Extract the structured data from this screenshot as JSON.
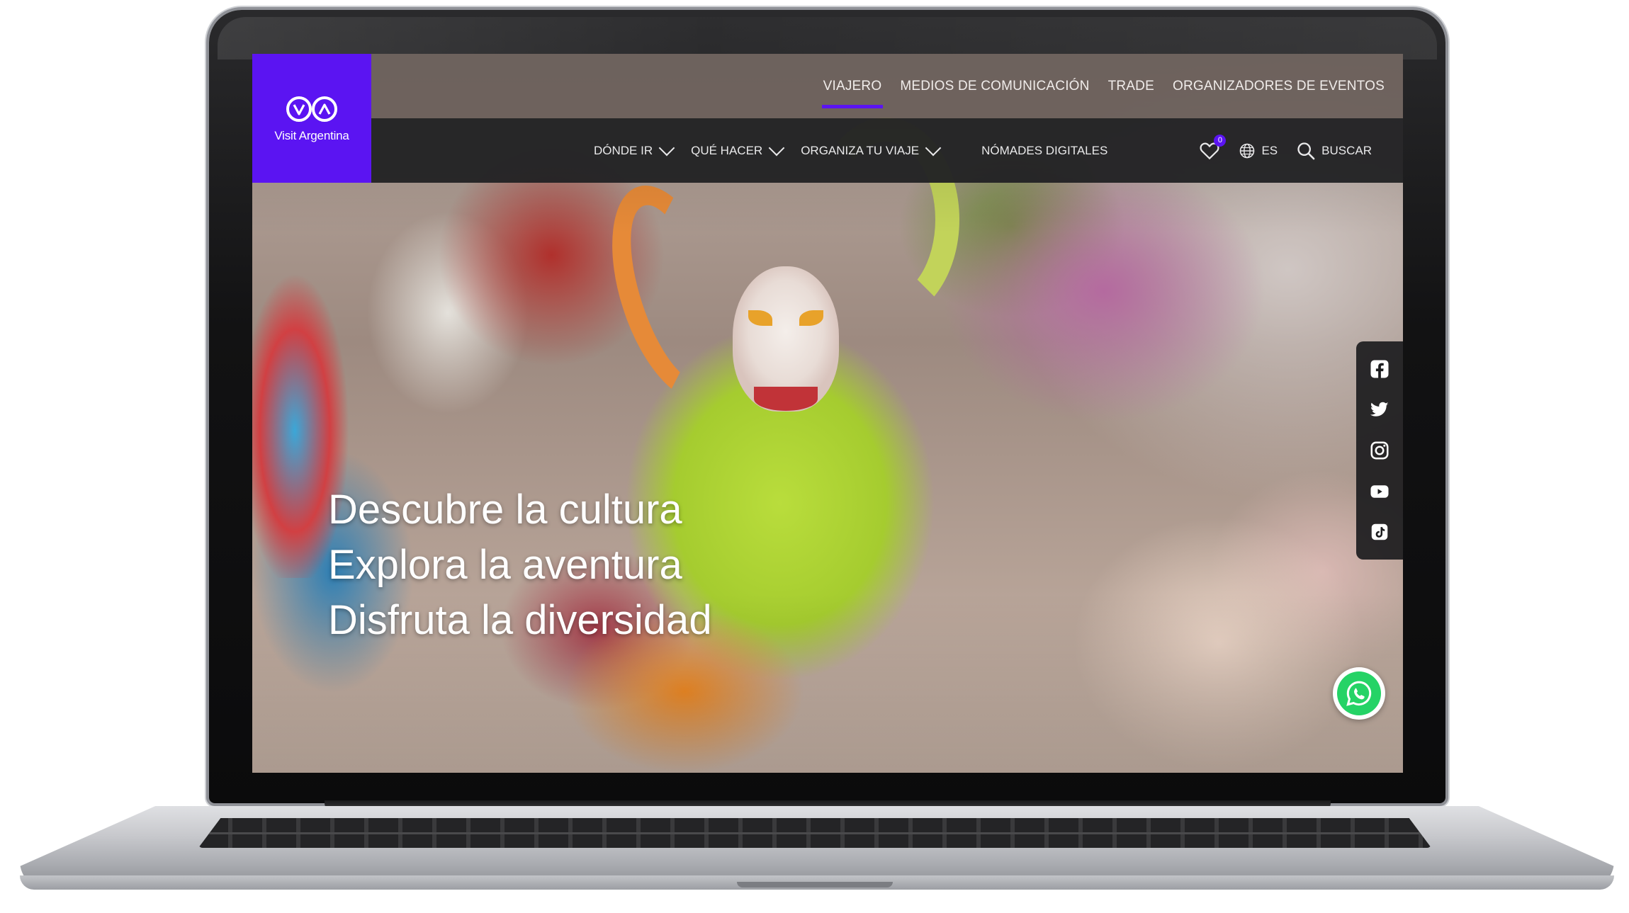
{
  "brand": {
    "name": "Visit Argentina",
    "accent": "#5b14f2"
  },
  "top_nav": {
    "items": [
      "VIAJERO",
      "MEDIOS DE COMUNICACIÓN",
      "TRADE",
      "ORGANIZADORES DE EVENTOS"
    ],
    "active_index": 0
  },
  "main_nav": {
    "items": [
      {
        "label": "DÓNDE IR",
        "has_dropdown": true
      },
      {
        "label": "QUÉ HACER",
        "has_dropdown": true
      },
      {
        "label": "ORGANIZA TU VIAJE",
        "has_dropdown": true
      },
      {
        "label": "NÓMADES DIGITALES",
        "has_dropdown": false
      }
    ],
    "favorites": {
      "icon": "heart-icon",
      "count": "0"
    },
    "language": {
      "icon": "globe-icon",
      "label": "ES"
    },
    "search": {
      "icon": "search-icon",
      "label": "BUSCAR"
    }
  },
  "hero": {
    "lines": [
      "Descubre la cultura",
      "Explora la aventura",
      "Disfruta la diversidad"
    ]
  },
  "social": [
    "facebook-icon",
    "twitter-icon",
    "instagram-icon",
    "youtube-icon",
    "tiktok-icon"
  ],
  "whatsapp": {
    "icon": "whatsapp-icon",
    "color": "#25d366"
  }
}
